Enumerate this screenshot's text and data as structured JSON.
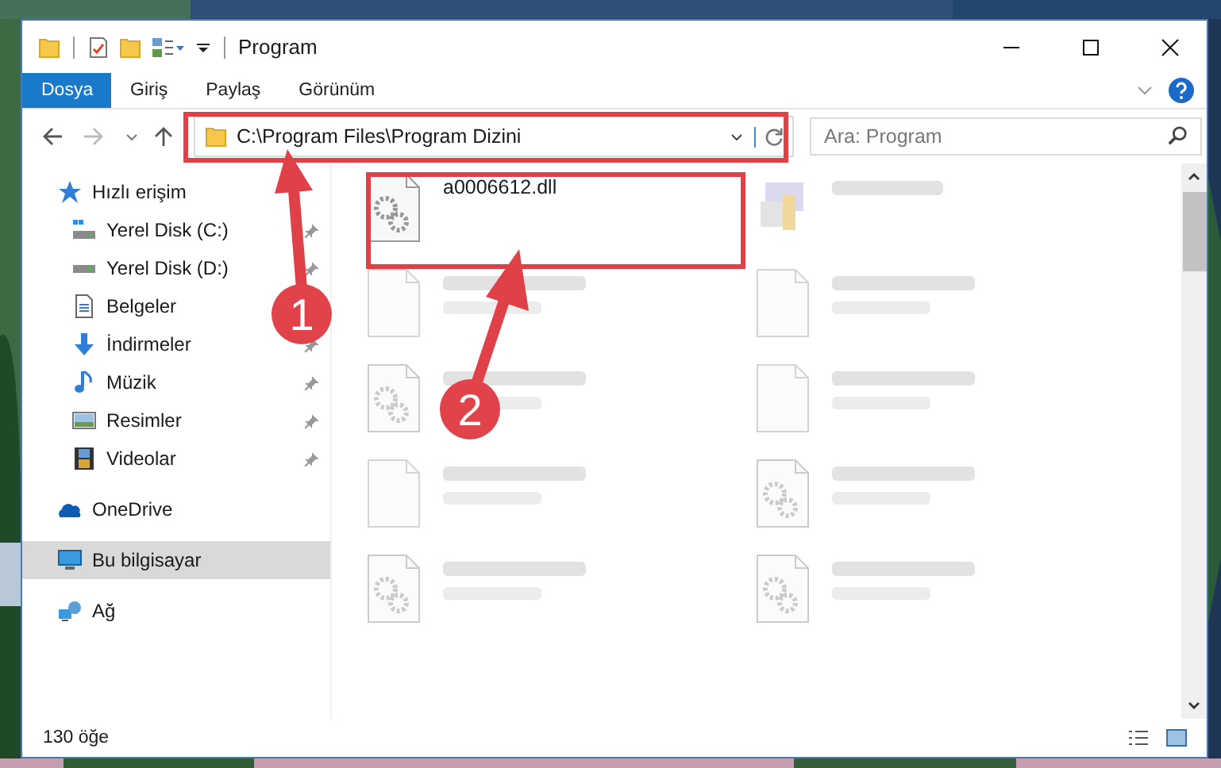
{
  "window": {
    "title": "Program"
  },
  "ribbon_tabs": [
    {
      "label": "Dosya",
      "selected": true
    },
    {
      "label": "Giriş",
      "selected": false
    },
    {
      "label": "Paylaş",
      "selected": false
    },
    {
      "label": "Görünüm",
      "selected": false
    }
  ],
  "address": {
    "path": "C:\\Program Files\\Program Dizini"
  },
  "search": {
    "placeholder": "Ara: Program"
  },
  "sidebar": [
    {
      "label": "Hızlı erişim",
      "kind": "star",
      "selected": false,
      "children": [
        {
          "label": "Yerel Disk (C:)",
          "kind": "systemdrive",
          "pinned": true,
          "selected": false
        },
        {
          "label": "Yerel Disk (D:)",
          "kind": "drive",
          "pinned": true,
          "selected": false
        },
        {
          "label": "Belgeler",
          "kind": "document",
          "pinned": false,
          "selected": false
        },
        {
          "label": "İndirmeler",
          "kind": "download",
          "pinned": true,
          "selected": false
        },
        {
          "label": "Müzik",
          "kind": "music",
          "pinned": true,
          "selected": false
        },
        {
          "label": "Resimler",
          "kind": "pictures",
          "pinned": true,
          "selected": false
        },
        {
          "label": "Videolar",
          "kind": "video",
          "pinned": true,
          "selected": false
        }
      ]
    },
    {
      "label": "OneDrive",
      "kind": "cloud",
      "selected": false
    },
    {
      "label": "Bu bilgisayar",
      "kind": "computer",
      "selected": true
    },
    {
      "label": "Ağ",
      "kind": "network",
      "selected": false
    }
  ],
  "files": [
    {
      "name": "a0006612.dll",
      "kind": "dll",
      "blurred": false
    },
    {
      "kind": "exe",
      "blurred": true
    },
    {
      "kind": "blank",
      "blurred": true
    },
    {
      "kind": "blank",
      "blurred": true
    },
    {
      "kind": "dll",
      "blurred": true
    },
    {
      "kind": "blank",
      "blurred": true
    },
    {
      "kind": "blank",
      "blurred": true
    },
    {
      "kind": "dll",
      "blurred": true
    },
    {
      "kind": "dll",
      "blurred": true
    },
    {
      "kind": "dll",
      "blurred": true
    }
  ],
  "status_bar": {
    "item_count": "130 öğe"
  },
  "annotations": [
    {
      "number": "1"
    },
    {
      "number": "2"
    }
  ]
}
